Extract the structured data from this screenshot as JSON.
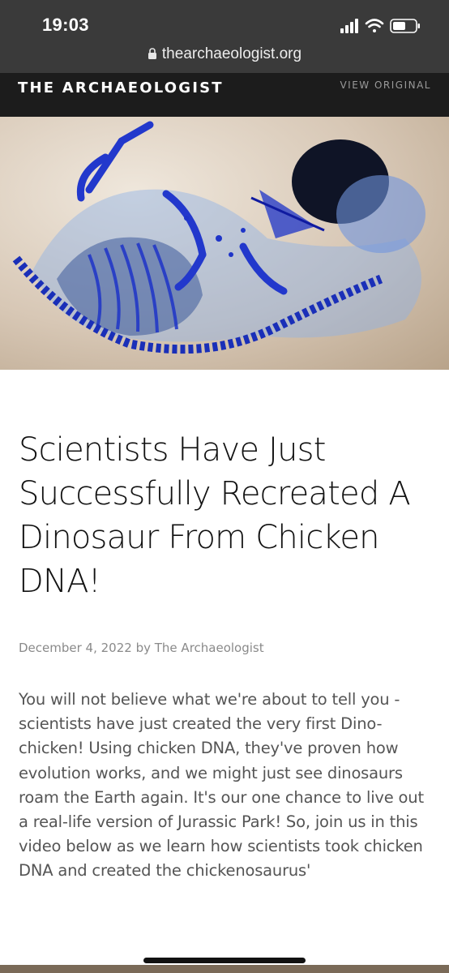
{
  "status_bar": {
    "time": "19:03",
    "icons": [
      "signal-icon",
      "wifi-icon",
      "battery-icon"
    ]
  },
  "browser": {
    "url": "thearchaeologist.org"
  },
  "site_header": {
    "title": "THE ARCHAEOLOGIST",
    "view_original": "VIEW ORIGINAL"
  },
  "article": {
    "hero_image": "stained-chicken-embryo-skeleton",
    "headline": "Scientists Have Just Successfully Recreated A Dinosaur From Chicken DNA!",
    "date": "December 4, 2022",
    "byline": "by The Archaeologist",
    "body": "You will not believe what we're about to tell you - scientists have just created the very first Dino-chicken! Using chicken DNA, they've proven how evolution works, and we might just see dinosaurs roam the Earth again. It's our one chance to live out a real-life version of Jurassic Park! So, join us in this video below as we learn how scientists took chicken DNA and created the chickenosaurus'"
  },
  "colors": {
    "status_bg": "#3a3a3a",
    "header_bg": "#1c1c1c",
    "stain_blue": "#1e34c8"
  }
}
